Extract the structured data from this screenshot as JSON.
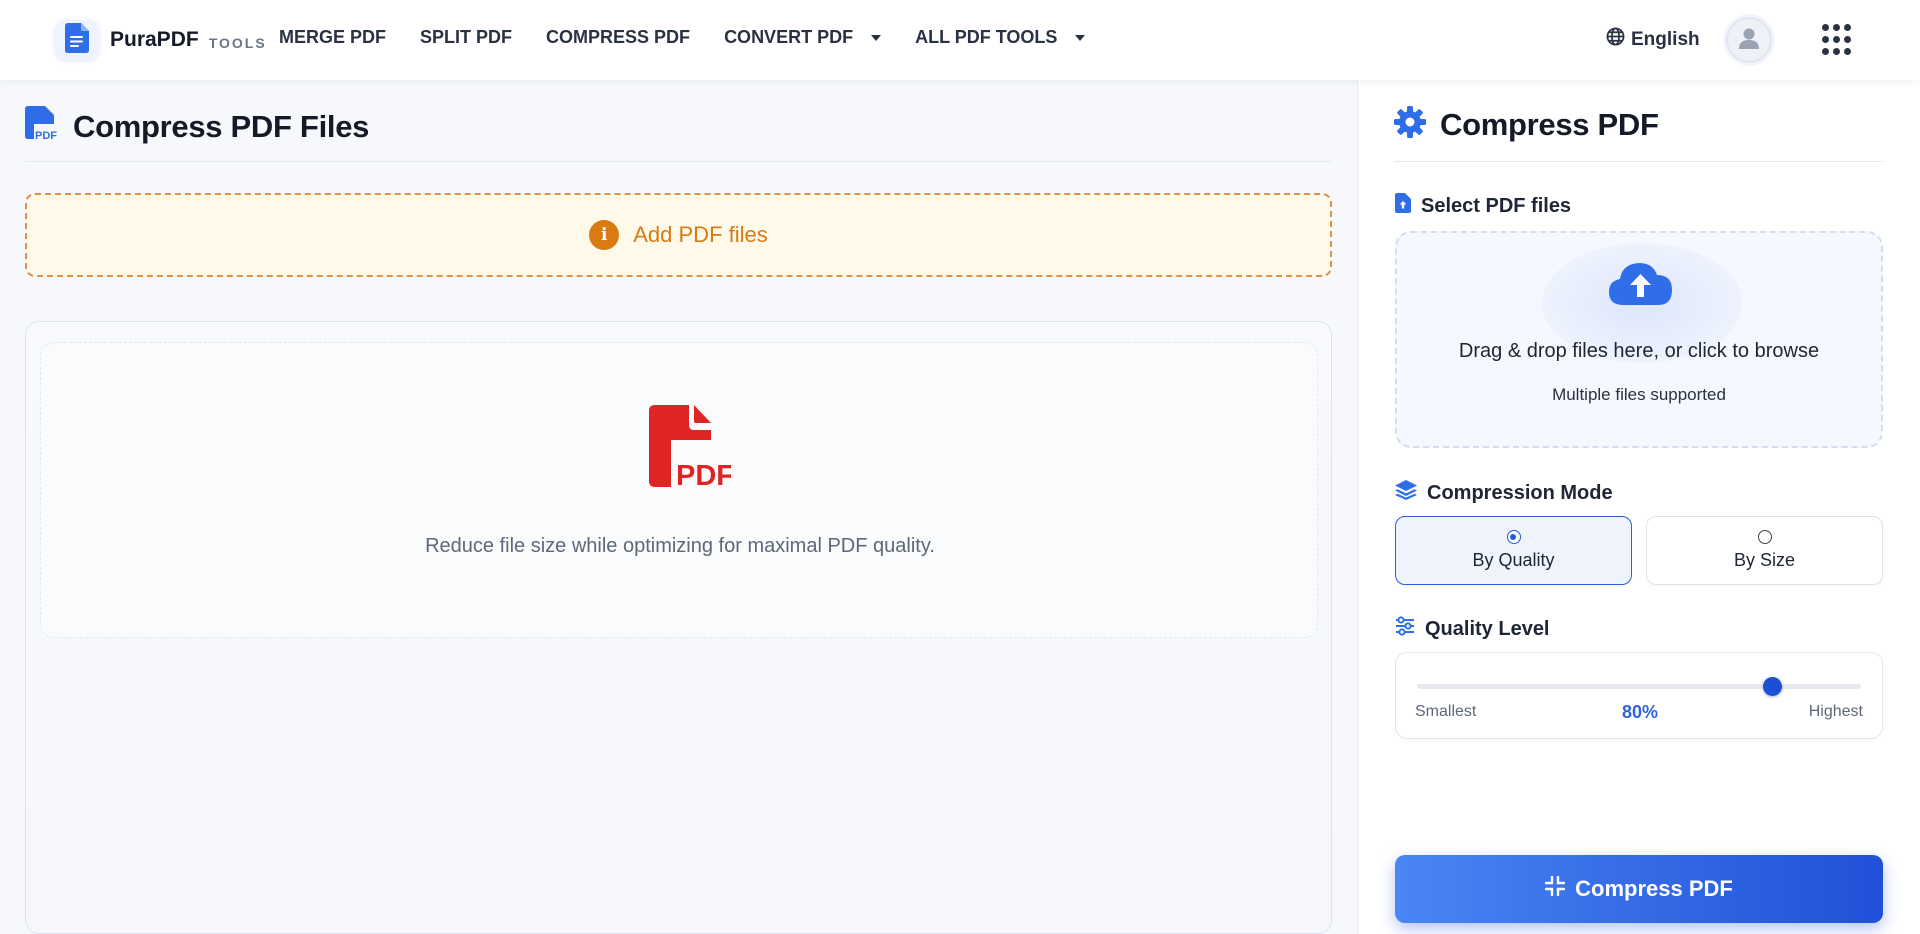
{
  "brand": {
    "name": "PuraPDF",
    "sub": "TOOLS"
  },
  "nav": {
    "items": [
      {
        "label": "MERGE PDF"
      },
      {
        "label": "SPLIT PDF"
      },
      {
        "label": "COMPRESS PDF"
      },
      {
        "label": "CONVERT PDF"
      },
      {
        "label": "ALL PDF TOOLS"
      }
    ],
    "language": "English"
  },
  "main": {
    "title": "Compress PDF Files",
    "notice": "Add PDF files",
    "caption": "Reduce file size while optimizing for maximal PDF quality."
  },
  "side": {
    "title": "Compress PDF",
    "select_label": "Select PDF files",
    "upload_main": "Drag & drop files here, or click to browse",
    "upload_sub": "Multiple files supported",
    "mode_label": "Compression Mode",
    "modes": [
      {
        "label": "By Quality",
        "selected": true
      },
      {
        "label": "By Size",
        "selected": false
      }
    ],
    "quality_label": "Quality Level",
    "quality": {
      "min_label": "Smallest",
      "max_label": "Highest",
      "value_text": "80%",
      "value": 0.8
    },
    "submit": "Compress PDF"
  },
  "colors": {
    "accent": "#1e5be0",
    "warning": "#d97a12",
    "pdf_red": "#e02424"
  },
  "icons": [
    "file-text-icon",
    "globe-icon",
    "user-icon",
    "apps-grid-icon",
    "pdf-file-icon",
    "info-icon",
    "gear-icon",
    "file-upload-icon",
    "cloud-upload-icon",
    "layers-icon",
    "sliders-icon",
    "compress-icon"
  ]
}
